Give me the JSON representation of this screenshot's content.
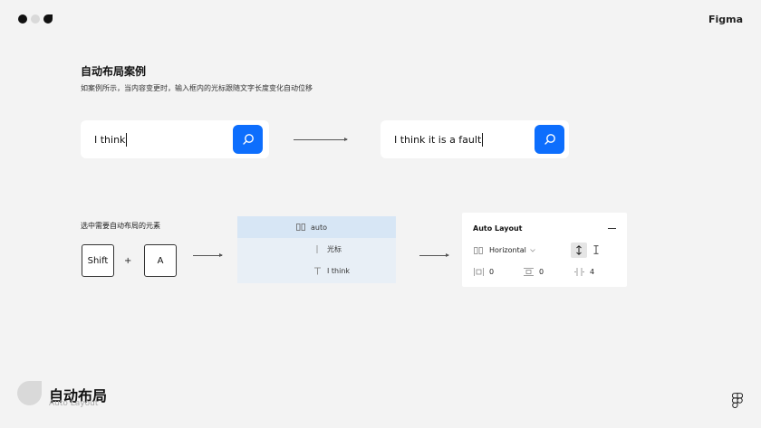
{
  "brand": "Figma",
  "title": "自动布局案例",
  "subtitle": "如案例所示，当内容变更时，输入框内的光标跟随文字长度变化自动位移",
  "search_before": {
    "text": "I think",
    "icon": "search-icon"
  },
  "search_after": {
    "text": "I think it is a fault",
    "icon": "search-icon"
  },
  "step_label": "选中需要自动布局的元素",
  "keys": {
    "shift": "Shift",
    "plus": "+",
    "a": "A"
  },
  "layers": {
    "items": [
      {
        "label": "auto",
        "icon": "frame-icon"
      },
      {
        "label": "光标",
        "icon": "line-icon"
      },
      {
        "label": "I think",
        "icon": "text-icon"
      }
    ]
  },
  "auto_layout": {
    "title": "Auto Layout",
    "direction": "Horizontal",
    "padding_h": "0",
    "padding_v": "0",
    "spacing": "4"
  },
  "footer": {
    "title": "自动布局",
    "subtitle": "Auto Layout"
  },
  "colors": {
    "accent": "#0d6efd",
    "background": "#f3f3f3"
  }
}
